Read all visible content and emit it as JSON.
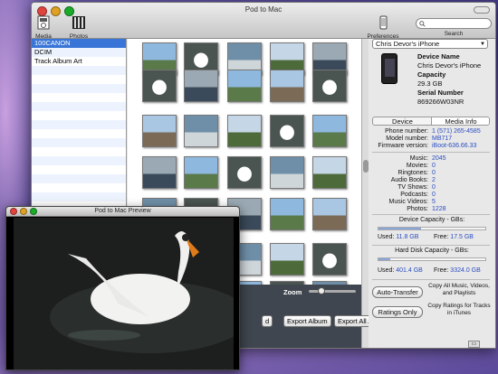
{
  "window": {
    "title": "Pod to Mac"
  },
  "toolbar": {
    "media_label": "Media",
    "photos_label": "Photos",
    "preferences_label": "Preferences",
    "search_label": "Search"
  },
  "sidebar": {
    "items": [
      {
        "label": "100CANON",
        "selected": true
      },
      {
        "label": "DCIM"
      },
      {
        "label": "Track Album Art"
      }
    ]
  },
  "bottom_bar": {
    "zoom_label": "Zoom",
    "export_selected_partial": "d",
    "export_album_label": "Export Album",
    "export_all_label": "Export All Albums"
  },
  "device": {
    "selected": "Chris Devor's iPhone",
    "name_key": "Device Name",
    "name_value": "Chris Devor's iPhone",
    "capacity_key": "Capacity",
    "capacity_value": "29.3 GB",
    "serial_key": "Serial Number",
    "serial_value": "869266W03NR"
  },
  "tabs": {
    "device": "Device",
    "media_info": "Media Info",
    "active": "Media Info"
  },
  "device_details": [
    {
      "key": "Phone number:",
      "value": "1 (571) 265-4585"
    },
    {
      "key": "Model number:",
      "value": "MB717"
    },
    {
      "key": "Firmware version:",
      "value": "iBoot-636.66.33"
    }
  ],
  "media_counts": [
    {
      "key": "Music:",
      "value": "2045"
    },
    {
      "key": "Movies:",
      "value": "0"
    },
    {
      "key": "Ringtones:",
      "value": "0"
    },
    {
      "key": "Audio Books:",
      "value": "2"
    },
    {
      "key": "TV Shows:",
      "value": "0"
    },
    {
      "key": "Podcasts:",
      "value": "0"
    },
    {
      "key": "Music Videos:",
      "value": "5"
    },
    {
      "key": "Photos:",
      "value": "1228"
    }
  ],
  "device_capacity": {
    "title": "Device Capacity - GBs:",
    "used_label": "Used:",
    "used": "11.8 GB",
    "free_label": "Free:",
    "free": "17.5 GB",
    "used_fraction": 0.4
  },
  "disk_capacity": {
    "title": "Hard Disk Capacity - GBs:",
    "used_label": "Used:",
    "used": "401.4 GB",
    "free_label": "Free:",
    "free": "3324.0 GB",
    "used_fraction": 0.11
  },
  "actions": {
    "auto_transfer": "Auto-Transfer",
    "auto_transfer_note": "Copy All Music, Videos, and Playlists",
    "ratings_only": "Ratings Only",
    "ratings_note": "Copy Ratings for Tracks in iTunes"
  },
  "preview": {
    "title": "Pod to Mac Preview"
  },
  "colors": {
    "accent": "#3875d7",
    "link": "#2a4cc2",
    "bottom_bar": "#3f464f"
  }
}
